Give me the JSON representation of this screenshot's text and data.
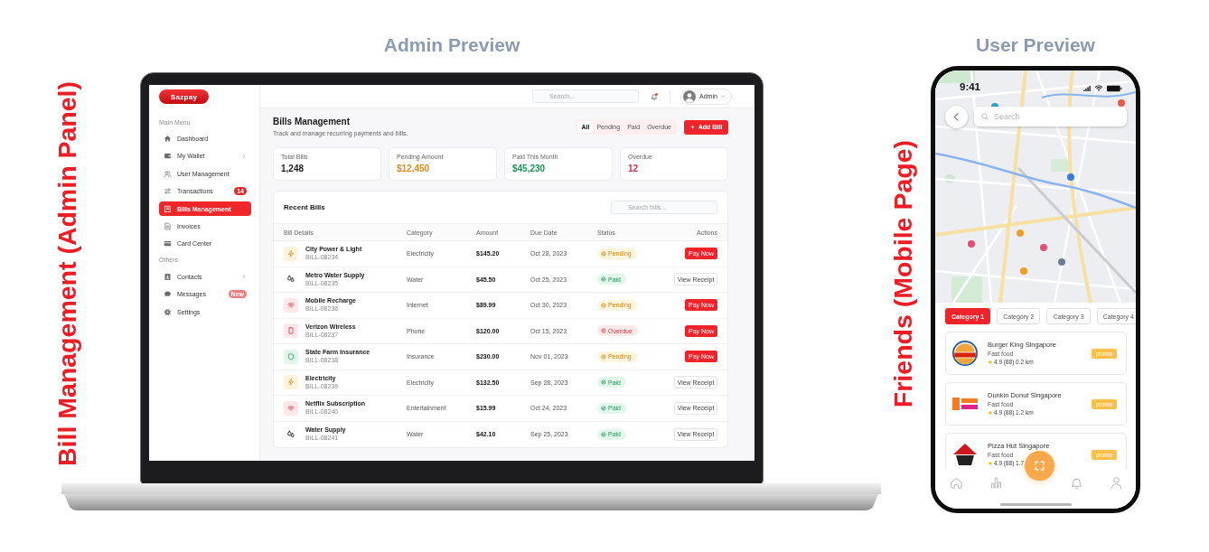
{
  "admin_caption": "Bill Management (Admin Panel)",
  "admin_preview": {
    "title": "Admin Preview",
    "sidebar": {
      "logo": "Sazpay",
      "sections": [
        {
          "title": "Main Menu",
          "items": [
            {
              "label": "Dashboard",
              "selected": false,
              "expandable": false
            },
            {
              "label": "My Wallet",
              "selected": false,
              "expandable": true
            },
            {
              "label": "User Management",
              "selected": false,
              "expandable": false
            },
            {
              "label": "Transactions",
              "selected": false,
              "expandable": false,
              "badge": {
                "text": "14",
                "kind": "count"
              }
            },
            {
              "label": "Bills Management",
              "selected": true,
              "expandable": false
            },
            {
              "label": "Invoices",
              "selected": false,
              "expandable": false
            },
            {
              "label": "Card Center",
              "selected": false,
              "expandable": false
            }
          ]
        },
        {
          "title": "Others",
          "items": [
            {
              "label": "Contacts",
              "selected": false,
              "expandable": true
            },
            {
              "label": "Messages",
              "selected": false,
              "expandable": false,
              "badge": {
                "text": "New",
                "kind": "new"
              }
            },
            {
              "label": "Settings",
              "selected": false,
              "expandable": false
            }
          ]
        }
      ]
    },
    "header": {
      "search": {
        "placeholder": "Search..."
      },
      "notifications": {
        "unread": true
      },
      "user": {
        "name": "Admin"
      }
    },
    "page": {
      "title": "Bills Management",
      "subtitle": "Track and manage recurring payments and bills.",
      "filters": [
        {
          "label": "All",
          "selected": true
        },
        {
          "label": "Pending",
          "selected": false
        },
        {
          "label": "Paid",
          "selected": false
        },
        {
          "label": "Overdue",
          "selected": false
        }
      ],
      "add_button": "Add Bill"
    },
    "stats": [
      {
        "label": "Total Bills",
        "value": "1,248",
        "color": "#1c1c1e"
      },
      {
        "label": "Pending Amount",
        "value": "$12,450",
        "color": "#e08a1e"
      },
      {
        "label": "Paid This Month",
        "value": "$45,230",
        "color": "#1e9257"
      },
      {
        "label": "Overdue",
        "value": "12",
        "color": "#dc2f45"
      }
    ],
    "recent_bills": {
      "title": "Recent Bills",
      "search": {
        "placeholder": "Search bills..."
      },
      "columns": [
        "Bill Details",
        "Category",
        "Amount",
        "Due Date",
        "Status",
        "Actions"
      ],
      "rows": [
        {
          "kind": "electricity",
          "name": "City Power & Light",
          "id": "BILL-08234",
          "category": "Electricity",
          "amount": "$145.20",
          "due_date": "Oct 28, 2023",
          "status": {
            "text": "Pending",
            "kind": "pending"
          },
          "action": {
            "text": "Pay Now",
            "kind": "pay"
          }
        },
        {
          "kind": "water",
          "name": "Metro Water Supply",
          "id": "BILL-08235",
          "category": "Water",
          "amount": "$45.50",
          "due_date": "Oct 25, 2023",
          "status": {
            "text": "Paid",
            "kind": "paid"
          },
          "action": {
            "text": "View Receipt",
            "kind": "receipt"
          }
        },
        {
          "kind": "internet",
          "name": "Mobile Recharge",
          "id": "BILL-08236",
          "category": "Internet",
          "amount": "$89.99",
          "due_date": "Oct 30, 2023",
          "status": {
            "text": "Pending",
            "kind": "pending"
          },
          "action": {
            "text": "Pay Now",
            "kind": "pay"
          }
        },
        {
          "kind": "phone",
          "name": "Verizon Wireless",
          "id": "BILL-08237",
          "category": "Phone",
          "amount": "$120.00",
          "due_date": "Oct 15, 2023",
          "status": {
            "text": "Overdue",
            "kind": "overdue"
          },
          "action": {
            "text": "Pay Now",
            "kind": "pay"
          }
        },
        {
          "kind": "insurance",
          "name": "State Farm Insurance",
          "id": "BILL-08238",
          "category": "Insurance",
          "amount": "$230.00",
          "due_date": "Nov 01, 2023",
          "status": {
            "text": "Pending",
            "kind": "pending"
          },
          "action": {
            "text": "Pay Now",
            "kind": "pay"
          }
        },
        {
          "kind": "electricity",
          "name": "Electricity",
          "id": "BILL-08239",
          "category": "Electricity",
          "amount": "$132.50",
          "due_date": "Sep 28, 2023",
          "status": {
            "text": "Paid",
            "kind": "paid"
          },
          "action": {
            "text": "View Receipt",
            "kind": "receipt"
          }
        },
        {
          "kind": "entertainment",
          "name": "Netflix Subscription",
          "id": "BILL-08240",
          "category": "Entertainment",
          "amount": "$15.99",
          "due_date": "Oct 24, 2023",
          "status": {
            "text": "Paid",
            "kind": "paid"
          },
          "action": {
            "text": "View Receipt",
            "kind": "receipt"
          }
        },
        {
          "kind": "water",
          "name": "Water Supply",
          "id": "BILL-08241",
          "category": "Water",
          "amount": "$42.10",
          "due_date": "Sep 25, 2023",
          "status": {
            "text": "Paid",
            "kind": "paid"
          },
          "action": {
            "text": "View Receipt",
            "kind": "receipt"
          }
        }
      ]
    }
  },
  "user_caption": "Friends (Mobile Page)",
  "user_preview": {
    "title": "User Preview",
    "status_bar": {
      "time": "9:41"
    },
    "search": {
      "placeholder": "Search"
    },
    "categories": [
      {
        "label": "Category 1",
        "selected": true
      },
      {
        "label": "Category 2",
        "selected": false
      },
      {
        "label": "Category 3",
        "selected": false
      },
      {
        "label": "Category 4",
        "selected": false
      }
    ],
    "restaurants": [
      {
        "name": "Burger King Singapore",
        "type": "Fast food",
        "rating": "4.9",
        "reviews": "(88)",
        "distance": "0.2 km",
        "badge": "promo"
      },
      {
        "name": "Dunkin Donut Singapore",
        "type": "Fast food",
        "rating": "4.9",
        "reviews": "(88)",
        "distance": "1.2 km",
        "badge": "promo"
      },
      {
        "name": "Pizza Hut Singapore",
        "type": "Fast food",
        "rating": "4.9",
        "reviews": "(88)",
        "distance": "1.7",
        "badge": "promo"
      }
    ]
  }
}
